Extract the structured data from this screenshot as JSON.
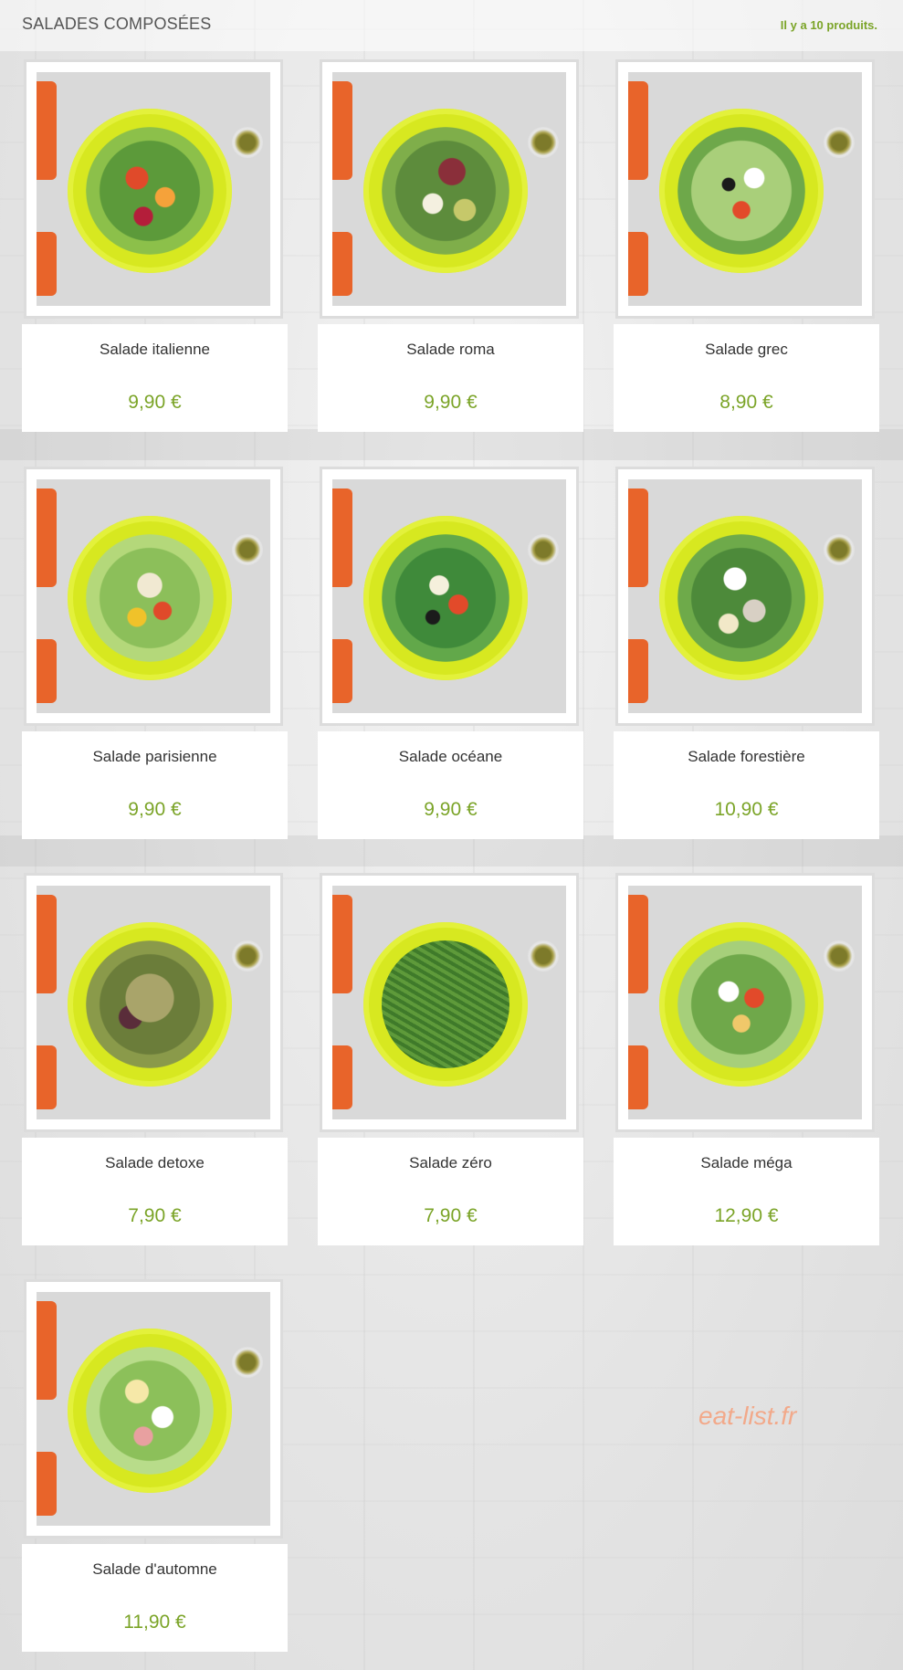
{
  "header": {
    "title": "SALADES COMPOSÉES",
    "count": "Il y a 10 produits."
  },
  "products": [
    {
      "name": "Salade italienne",
      "price": "9,90 €"
    },
    {
      "name": "Salade roma",
      "price": "9,90 €"
    },
    {
      "name": "Salade grec",
      "price": "8,90 €"
    },
    {
      "name": "Salade parisienne",
      "price": "9,90 €"
    },
    {
      "name": "Salade océane",
      "price": "9,90 €"
    },
    {
      "name": "Salade forestière",
      "price": "10,90 €"
    },
    {
      "name": "Salade detoxe",
      "price": "7,90 €"
    },
    {
      "name": "Salade zéro",
      "price": "7,90 €"
    },
    {
      "name": "Salade méga",
      "price": "12,90 €"
    },
    {
      "name": "Salade d'automne",
      "price": "11,90 €"
    }
  ],
  "watermark": "eat-list.fr",
  "colors": {
    "accent_green": "#7ba428",
    "plate": "#d7e820",
    "napkin": "#e8642a",
    "watermark": "#f2a98a"
  }
}
